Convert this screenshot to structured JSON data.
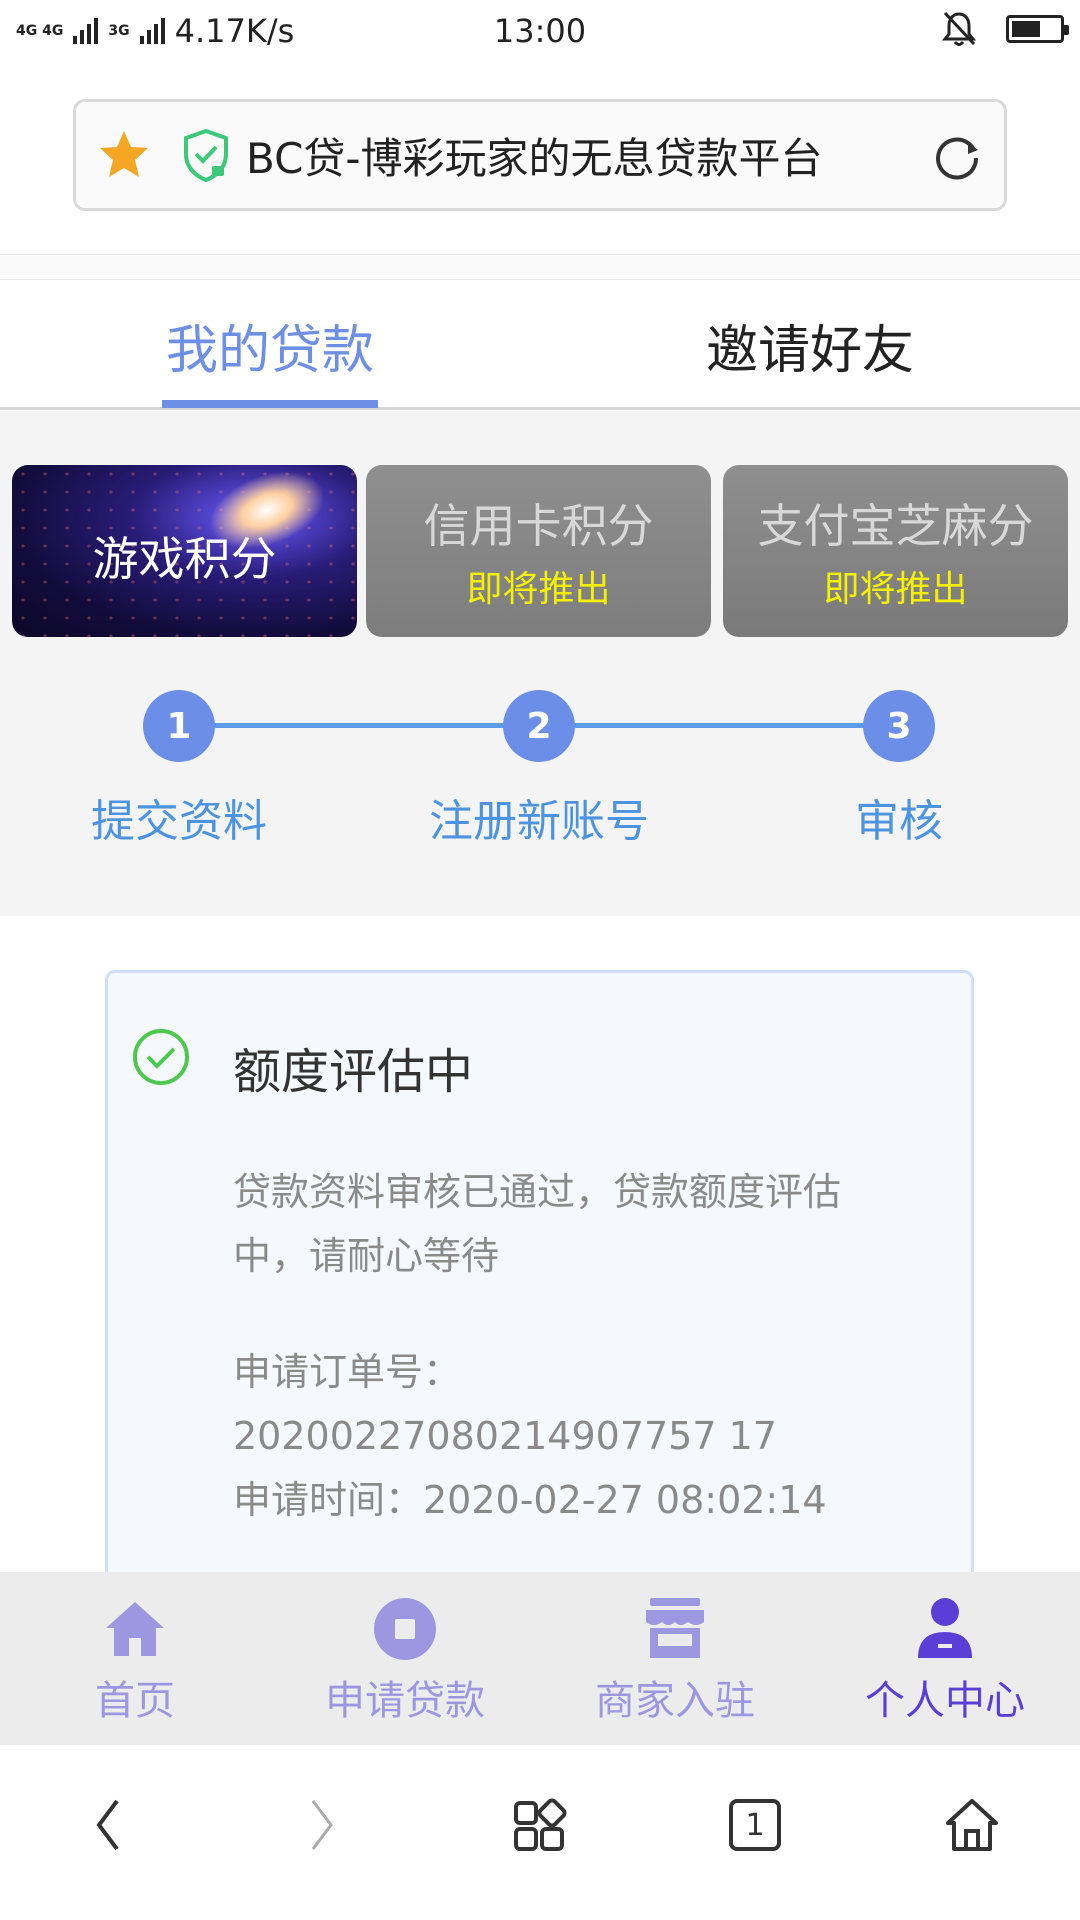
{
  "status_bar": {
    "network_1": "4G 4G",
    "network_2": "3G",
    "speed": "4.17K/s",
    "time": "13:00"
  },
  "url_bar": {
    "title": "BC贷-博彩玩家的无息贷款平台",
    "star_color": "#f5a623",
    "shield_color": "#3cc97a"
  },
  "tabs": [
    {
      "label": "我的贷款",
      "active": true
    },
    {
      "label": "邀请好友",
      "active": false
    }
  ],
  "cards": {
    "game": {
      "title": "游戏积分"
    },
    "credit": {
      "title": "信用卡积分",
      "badge": "即将推出"
    },
    "alipay": {
      "title": "支付宝芝麻分",
      "badge": "即将推出"
    }
  },
  "steps": [
    {
      "number": "1",
      "label": "提交资料"
    },
    {
      "number": "2",
      "label": "注册新账号"
    },
    {
      "number": "3",
      "label": "审核"
    }
  ],
  "status": {
    "title": "额度评估中",
    "message_line1": "贷款资料审核已通过，贷款额度评估",
    "message_line2": "中，请耐心等待",
    "order_label": "申请订单号：",
    "order_number": "20200227080214907757 17",
    "time_label_value": "申请时间：2020-02-27 08:02:14",
    "check_color": "#4cc94c"
  },
  "bottom_nav": [
    {
      "label": "首页",
      "icon": "home-icon"
    },
    {
      "label": "申请贷款",
      "icon": "apply-icon"
    },
    {
      "label": "商家入驻",
      "icon": "store-icon"
    },
    {
      "label": "个人中心",
      "icon": "user-icon",
      "active": true
    }
  ],
  "browser_bar": {
    "tab_count": "1"
  },
  "colors": {
    "accent": "#6e8fe6",
    "step_blue": "#5b9bea",
    "nav_inactive": "#9d97e2",
    "nav_active": "#5a3fd6"
  }
}
